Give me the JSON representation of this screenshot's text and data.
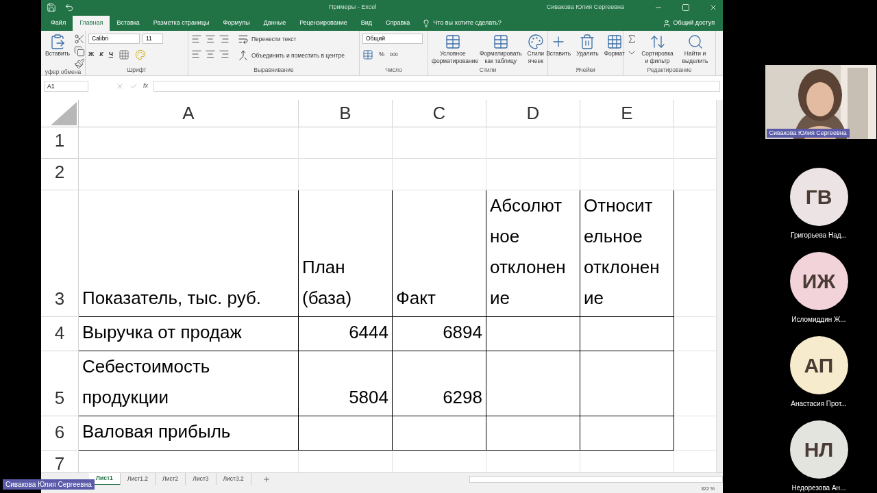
{
  "title_bar": {
    "title": "Примеры - Excel",
    "user": "Сивакова Юлия Сергеевна"
  },
  "menu_tabs": [
    {
      "label": "Файл",
      "selected": false
    },
    {
      "label": "Главная",
      "selected": true
    },
    {
      "label": "Вставка",
      "selected": false
    },
    {
      "label": "Разметка страницы",
      "selected": false
    },
    {
      "label": "Формулы",
      "selected": false
    },
    {
      "label": "Данные",
      "selected": false
    },
    {
      "label": "Рецензирование",
      "selected": false
    },
    {
      "label": "Вид",
      "selected": false
    },
    {
      "label": "Справка",
      "selected": false
    }
  ],
  "search_hint": "Что вы хотите сделать?",
  "share": "Общий доступ",
  "ribbon": {
    "clipboard": {
      "paste": "Вставить",
      "group": "уфер обмена"
    },
    "font": {
      "name": "Calibri",
      "size": "11",
      "bold": "Ж",
      "italic": "К",
      "underline": "Ч",
      "group": "Шрифт"
    },
    "alignment": {
      "wrap": "Перенести текст",
      "merge": "Объединить и поместить в центре",
      "group": "Выравнивание"
    },
    "number": {
      "format": "Общий",
      "percent": "%",
      "thousands": "000",
      "group": "Число"
    },
    "styles": {
      "buttons": [
        "Условное форматирование",
        "Форматировать как таблицу",
        "Стили ячеек"
      ],
      "group": "Стили"
    },
    "cells": {
      "buttons": [
        "Вставить",
        "Удалить",
        "Формат"
      ],
      "group": "Ячейки"
    },
    "editing": {
      "buttons": [
        "Сортировка и фильтр",
        "Найти и выделить"
      ],
      "group": "Редактирование"
    }
  },
  "name_box": "A1",
  "fx": "fx",
  "sheet": {
    "columns": [
      "A",
      "B",
      "C",
      "D",
      "E"
    ],
    "rows": [
      {
        "number": "1",
        "kind": "blank"
      },
      {
        "number": "2",
        "kind": "blank"
      },
      {
        "number": "3",
        "kind": "header",
        "cells": [
          "Показатель, тыс. руб.",
          "План (база)",
          "Факт",
          "Абсолютное отклонение",
          "Относительное отклонение"
        ]
      },
      {
        "number": "4",
        "kind": "data",
        "cells": [
          "Выручка от продаж",
          "6444",
          "6894"
        ]
      },
      {
        "number": "5",
        "kind": "data",
        "cells": [
          "Себестоимость продукции",
          "5804",
          "6298"
        ]
      },
      {
        "number": "6",
        "kind": "data",
        "cells": [
          "Валовая прибыль"
        ]
      },
      {
        "number": "7",
        "kind": "blank"
      }
    ]
  },
  "sheet_tabs": [
    {
      "label": "Лист1",
      "selected": true
    },
    {
      "label": "Лист1.2",
      "selected": false
    },
    {
      "label": "Лист2",
      "selected": false
    },
    {
      "label": "Лист3",
      "selected": false
    },
    {
      "label": "Лист3.2",
      "selected": false
    }
  ],
  "zoom": "322 %",
  "presenter": {
    "name": "Сивакова Юлия Сергеевна",
    "kind": "picture"
  },
  "screen_label": "Сивакова Юлия Сергеевна",
  "participants": [
    {
      "initials": "ГВ",
      "name": "Григорьева Над...",
      "color": "#ece4e4"
    },
    {
      "initials": "ИЖ",
      "name": "Исломиддин Ж...",
      "color": "#f2d3da"
    },
    {
      "initials": "АП",
      "name": "Анастасия Прот...",
      "color": "#f6ebcc"
    },
    {
      "initials": "НЛ",
      "name": "Недорезова Ан...",
      "color": "#e4e4df"
    }
  ]
}
